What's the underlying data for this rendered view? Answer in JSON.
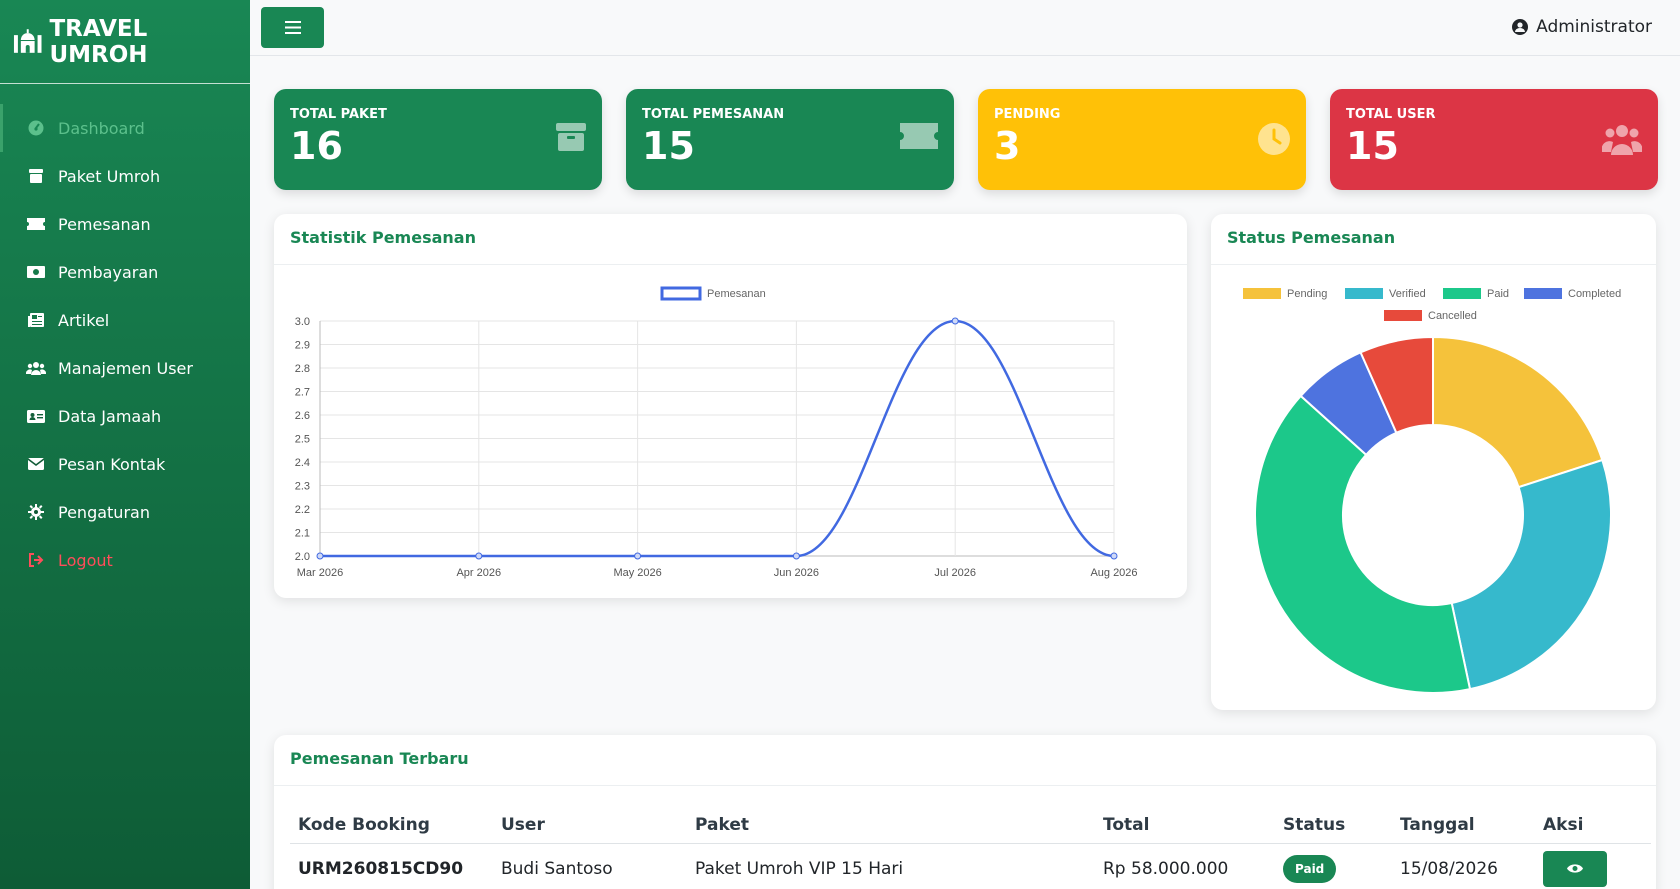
{
  "app": {
    "brand": "TRAVEL UMROH",
    "user_name": "Administrator"
  },
  "sidebar": {
    "items": [
      {
        "label": "Dashboard",
        "icon": "dashboard-icon",
        "active": true
      },
      {
        "label": "Paket Umroh",
        "icon": "box-icon"
      },
      {
        "label": "Pemesanan",
        "icon": "ticket-icon"
      },
      {
        "label": "Pembayaran",
        "icon": "money-icon"
      },
      {
        "label": "Artikel",
        "icon": "newspaper-icon"
      },
      {
        "label": "Manajemen User",
        "icon": "users-icon"
      },
      {
        "label": "Data Jamaah",
        "icon": "id-card-icon"
      },
      {
        "label": "Pesan Kontak",
        "icon": "envelope-icon"
      },
      {
        "label": "Pengaturan",
        "icon": "gear-icon"
      },
      {
        "label": "Logout",
        "icon": "logout-icon"
      }
    ]
  },
  "stats": [
    {
      "label": "TOTAL PAKET",
      "value": "16",
      "color": "#198754",
      "icon": "box-icon"
    },
    {
      "label": "TOTAL PEMESANAN",
      "value": "15",
      "color": "#198754",
      "icon": "ticket-icon"
    },
    {
      "label": "PENDING",
      "value": "3",
      "color": "#ffc107",
      "icon": "clock-icon"
    },
    {
      "label": "TOTAL USER",
      "value": "15",
      "color": "#dc3545",
      "icon": "users-icon"
    }
  ],
  "line_panel": {
    "title": "Statistik Pemesanan"
  },
  "donut_panel": {
    "title": "Status Pemesanan"
  },
  "table_panel": {
    "title": "Pemesanan Terbaru",
    "headers": [
      "Kode Booking",
      "User",
      "Paket",
      "Total",
      "Status",
      "Tanggal",
      "Aksi"
    ],
    "rows": [
      {
        "code": "URM260815CD90",
        "user": "Budi Santoso",
        "paket": "Paket Umroh VIP 15 Hari",
        "total": "Rp 58.000.000",
        "status": "Paid",
        "tanggal": "15/08/2026"
      }
    ]
  },
  "chart_data": [
    {
      "type": "line",
      "legend": [
        "Pemesanan"
      ],
      "x": [
        "Mar 2026",
        "Apr 2026",
        "May 2026",
        "Jun 2026",
        "Jul 2026",
        "Aug 2026"
      ],
      "series": [
        {
          "name": "Pemesanan",
          "values": [
            2,
            2,
            2,
            2,
            3,
            2
          ],
          "color": "#4169e1"
        }
      ],
      "ylim": [
        2.0,
        3.0
      ],
      "yticks": [
        "3.0",
        "2.9",
        "2.8",
        "2.7",
        "2.6",
        "2.5",
        "2.4",
        "2.3",
        "2.2",
        "2.1",
        "2.0"
      ],
      "grid": true,
      "legend_position": "top"
    },
    {
      "type": "pie",
      "donut": true,
      "legend_position": "top",
      "slices": [
        {
          "label": "Pending",
          "value": 3,
          "color": "#f5c23b"
        },
        {
          "label": "Verified",
          "value": 4,
          "color": "#36b9cc"
        },
        {
          "label": "Paid",
          "value": 6,
          "color": "#1cc88a"
        },
        {
          "label": "Completed",
          "value": 1,
          "color": "#4e73df"
        },
        {
          "label": "Cancelled",
          "value": 1,
          "color": "#e74a3b"
        }
      ]
    }
  ]
}
